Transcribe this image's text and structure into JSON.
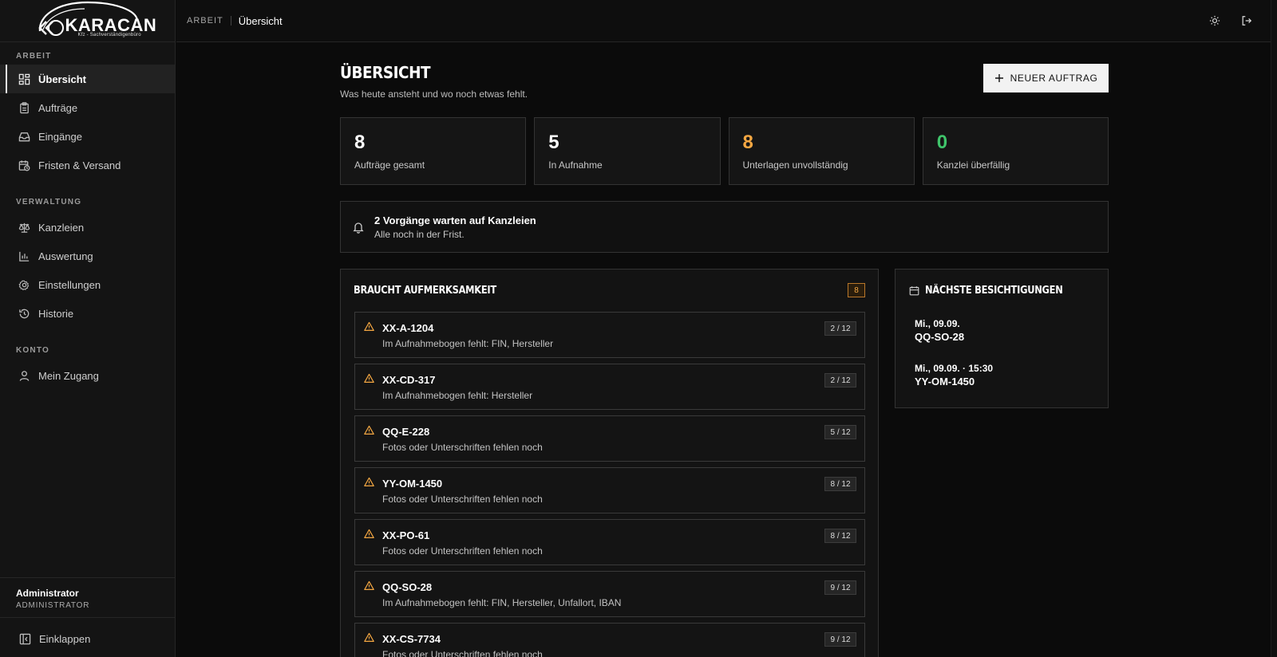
{
  "app": {
    "logo_text": "KARACAN",
    "logo_subtitle": "Kfz - Sachverständigenbüro"
  },
  "sidebar": {
    "sections": [
      {
        "title": "ARBEIT",
        "items": [
          {
            "label": "Übersicht",
            "icon": "dashboard-icon",
            "active": true
          },
          {
            "label": "Aufträge",
            "icon": "clipboard-icon"
          },
          {
            "label": "Eingänge",
            "icon": "inbox-icon"
          },
          {
            "label": "Fristen & Versand",
            "icon": "calendar-clock-icon"
          }
        ]
      },
      {
        "title": "VERWALTUNG",
        "items": [
          {
            "label": "Kanzleien",
            "icon": "scale-icon"
          },
          {
            "label": "Auswertung",
            "icon": "bar-chart-icon"
          },
          {
            "label": "Einstellungen",
            "icon": "gear-icon"
          },
          {
            "label": "Historie",
            "icon": "history-icon"
          }
        ]
      },
      {
        "title": "KONTO",
        "items": [
          {
            "label": "Mein Zugang",
            "icon": "user-icon"
          }
        ]
      }
    ],
    "user": {
      "name": "Administrator",
      "role": "ADMINISTRATOR"
    },
    "collapse_label": "Einklappen"
  },
  "topbar": {
    "breadcrumb_root": "ARBEIT",
    "breadcrumb_current": "Übersicht"
  },
  "page": {
    "title": "ÜBERSICHT",
    "subtitle": "Was heute ansteht und wo noch etwas fehlt.",
    "new_button_label": "NEUER AUFTRAG"
  },
  "stats": [
    {
      "value": "8",
      "label": "Aufträge gesamt",
      "color": "#ffffff"
    },
    {
      "value": "5",
      "label": "In Aufnahme",
      "color": "#ffffff"
    },
    {
      "value": "8",
      "label": "Unterlagen unvollständig",
      "color": "#f5a742"
    },
    {
      "value": "0",
      "label": "Kanzlei überfällig",
      "color": "#3fc46a"
    }
  ],
  "alert": {
    "title": "2 Vorgänge warten auf Kanzleien",
    "subtitle": "Alle noch in der Frist."
  },
  "attention": {
    "title": "BRAUCHT AUFMERKSAMKEIT",
    "count": "8",
    "items": [
      {
        "plate": "XX-A-1204",
        "desc": "Im Aufnahmebogen fehlt: FIN, Hersteller",
        "progress": "2 / 12"
      },
      {
        "plate": "XX-CD-317",
        "desc": "Im Aufnahmebogen fehlt: Hersteller",
        "progress": "2 / 12"
      },
      {
        "plate": "QQ-E-228",
        "desc": "Fotos oder Unterschriften fehlen noch",
        "progress": "5 / 12"
      },
      {
        "plate": "YY-OM-1450",
        "desc": "Fotos oder Unterschriften fehlen noch",
        "progress": "8 / 12"
      },
      {
        "plate": "XX-PO-61",
        "desc": "Fotos oder Unterschriften fehlen noch",
        "progress": "8 / 12"
      },
      {
        "plate": "QQ-SO-28",
        "desc": "Im Aufnahmebogen fehlt: FIN, Hersteller, Unfallort, IBAN",
        "progress": "9 / 12"
      },
      {
        "plate": "XX-CS-7734",
        "desc": "Fotos oder Unterschriften fehlen noch",
        "progress": "9 / 12"
      }
    ]
  },
  "visits": {
    "title": "NÄCHSTE BESICHTIGUNGEN",
    "items": [
      {
        "date": "Mi., 09.09.",
        "plate": "QQ-SO-28"
      },
      {
        "date": "Mi., 09.09. · 15:30",
        "plate": "YY-OM-1450"
      }
    ]
  },
  "colors": {
    "accent_warning": "#f5a742",
    "accent_success": "#3fc46a",
    "background": "#0b0b0b"
  }
}
